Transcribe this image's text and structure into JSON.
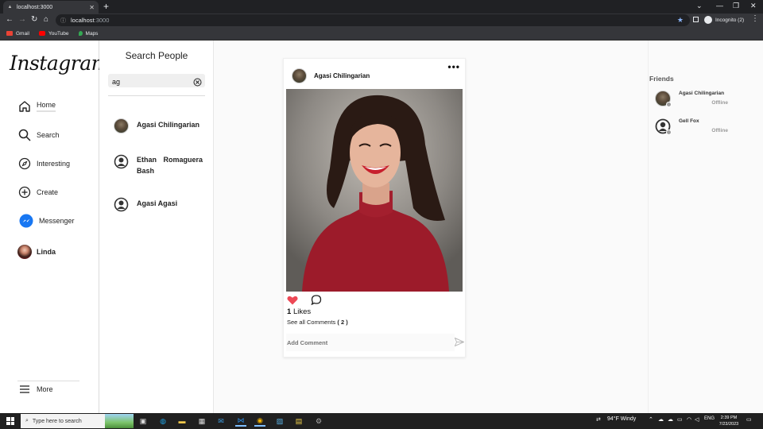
{
  "browser": {
    "tab_title": "localhost:3000",
    "new_tab_icon": "plus-icon",
    "url_host": "localhost",
    "url_port": ":3000",
    "incognito_label": "Incognito (2)",
    "bookmarks": [
      {
        "label": "Gmail",
        "color": "#ea4335"
      },
      {
        "label": "YouTube",
        "color": "#ff0000"
      },
      {
        "label": "Maps",
        "color": "#34a853"
      }
    ]
  },
  "sidebar": {
    "logo": "Instagram",
    "items": [
      {
        "label": "Home",
        "icon": "home-icon"
      },
      {
        "label": "Search",
        "icon": "search-icon"
      },
      {
        "label": "Interesting",
        "icon": "compass-icon"
      },
      {
        "label": "Create",
        "icon": "plus-circle-icon"
      },
      {
        "label": "Messenger",
        "icon": "messenger-icon"
      },
      {
        "label": "Linda",
        "icon": "avatar"
      }
    ],
    "more_label": "More"
  },
  "search_panel": {
    "title": "Search People",
    "query": "ag",
    "results": [
      {
        "name": "Agasi  Chilingarian",
        "avatar": "photo"
      },
      {
        "name": "Ethan  Romaguera Bash",
        "avatar": "default"
      },
      {
        "name": "Agasi  Agasi",
        "avatar": "default"
      }
    ]
  },
  "post": {
    "author": "Agasi  Chilingarian",
    "more_icon": "ellipsis-icon",
    "likes_count": "1",
    "likes_label": "Likes",
    "comments_prefix": "See all Comments",
    "comments_count": "( 2 )",
    "comment_placeholder": "Add Comment",
    "liked": true,
    "accent": "#ed4956"
  },
  "friends": {
    "title": "Friends",
    "list": [
      {
        "name": "Agasi  Chilingarian",
        "status": "Offline",
        "avatar": "photo"
      },
      {
        "name": "Gell  Fox",
        "status": "Offline",
        "avatar": "default"
      }
    ]
  },
  "taskbar": {
    "search_placeholder": "Type here to search",
    "weather": "94°F  Windy",
    "lang": "ENG",
    "time": "2:39 PM",
    "date": "7/23/2023"
  }
}
